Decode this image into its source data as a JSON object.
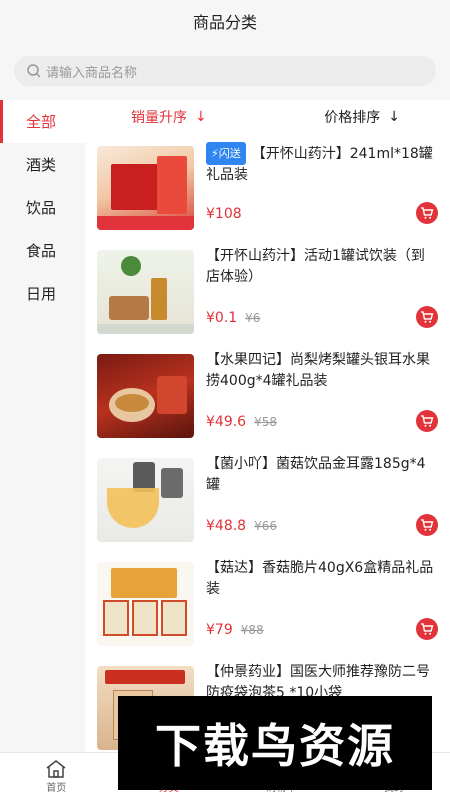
{
  "header": {
    "title": "商品分类"
  },
  "search": {
    "placeholder": "请输入商品名称"
  },
  "sidebar": {
    "items": [
      {
        "label": "全部"
      },
      {
        "label": "酒类"
      },
      {
        "label": "饮品"
      },
      {
        "label": "食品"
      },
      {
        "label": "日用"
      }
    ]
  },
  "sort": {
    "sales_label": "销量升序",
    "sales_arrow": "↓",
    "price_label": "价格排序",
    "price_arrow": "↓"
  },
  "products": [
    {
      "tag": "⚡闪送",
      "title": "【开怀山药汁】241ml*18罐礼品装",
      "price": "¥108",
      "old_price": ""
    },
    {
      "tag": "",
      "title": "【开怀山药汁】活动1罐试饮装（到店体验）",
      "price": "¥0.1",
      "old_price": "¥6"
    },
    {
      "tag": "",
      "title": "【水果四记】尚梨烤梨罐头银耳水果捞400g*4罐礼品装",
      "price": "¥49.6",
      "old_price": "¥58"
    },
    {
      "tag": "",
      "title": "【菌小吖】菌菇饮品金耳露185g*4罐",
      "price": "¥48.8",
      "old_price": "¥66"
    },
    {
      "tag": "",
      "title": "【菇达】香菇脆片40gX6盒精品礼品装",
      "price": "¥79",
      "old_price": "¥88"
    },
    {
      "tag": "",
      "title": "【仲景药业】国医大师推荐豫防二号防疫袋泡茶5 *10小袋",
      "price": "",
      "old_price": ""
    }
  ],
  "tabbar": {
    "items": [
      {
        "label": "首页"
      },
      {
        "label": "分类"
      },
      {
        "label": "购物车"
      },
      {
        "label": "我的"
      }
    ]
  },
  "watermark": {
    "text": "下载鸟资源"
  },
  "colors": {
    "accent": "#e2323a",
    "flash": "#2f86f0",
    "sidebar_bg": "#f6f6f6"
  }
}
